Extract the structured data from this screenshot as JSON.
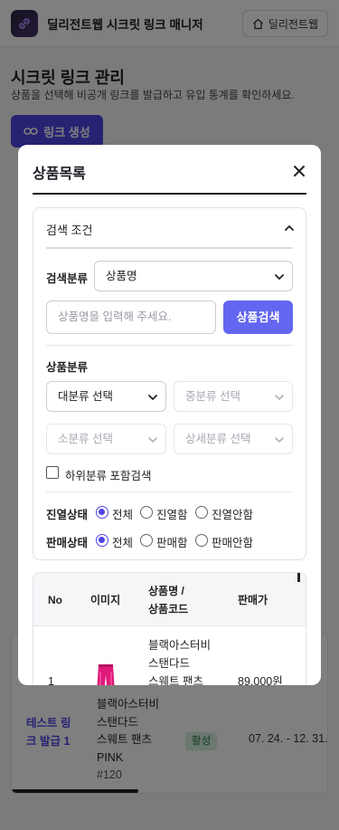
{
  "header": {
    "app_title": "딜리전트웹 시크릿 링크 매니저",
    "home_button": "딜리전트웹",
    "logo_icon": "link-icon"
  },
  "page": {
    "title": "시크릿 링크 관리",
    "subtitle": "상품을 선택해 비공개 링크를 발급하고 유입 통계를 확인하세요.",
    "create_button": "링크 생성"
  },
  "background_table": {
    "row": {
      "link_name": "테스트 링크 발급 1",
      "product_lines": [
        "블랙아스터비",
        "스탠다드",
        "스웨트 팬츠",
        "PINK"
      ],
      "product_code": "#120",
      "status": "활성",
      "period": "07. 24. - 12. 31."
    }
  },
  "modal": {
    "title": "상품목록",
    "close_icon": "close-icon",
    "search_panel": {
      "heading": "검색 조건",
      "search_type_label": "검색분류",
      "search_type_value": "상품명",
      "search_placeholder": "상품명을 입력해 주세요.",
      "search_button": "상품검색",
      "category_label": "상품분류",
      "category_large": "대분류 선택",
      "category_medium": "중분류 선택",
      "category_small": "소분류 선택",
      "category_detail": "상세분류 선택",
      "include_sub_label": "하위분류 포함검색",
      "display_label": "진열상태",
      "display_options": [
        "전체",
        "진열함",
        "진열안함"
      ],
      "display_selected": "전체",
      "sale_label": "판매상태",
      "sale_options": [
        "전체",
        "판매함",
        "판매안함"
      ],
      "sale_selected": "전체"
    },
    "results": {
      "columns": [
        "No",
        "이미지",
        "상품명 / 상품코드",
        "판매가"
      ],
      "col_product_lines": [
        "상품명 /",
        "상품코드"
      ],
      "rows": [
        {
          "no": "1",
          "image_icon": "pants-thumbnail",
          "name_lines": [
            "블랙아스터비",
            "스탠다드",
            "스웨트 팬츠"
          ],
          "price": "89,000원"
        }
      ]
    }
  },
  "colors": {
    "accent": "#4f46e5",
    "button": "#6366f1",
    "overlay": "rgba(0,0,0,0.5)",
    "status_bg": "#d4f1de",
    "status_fg": "#1f7a3f"
  }
}
